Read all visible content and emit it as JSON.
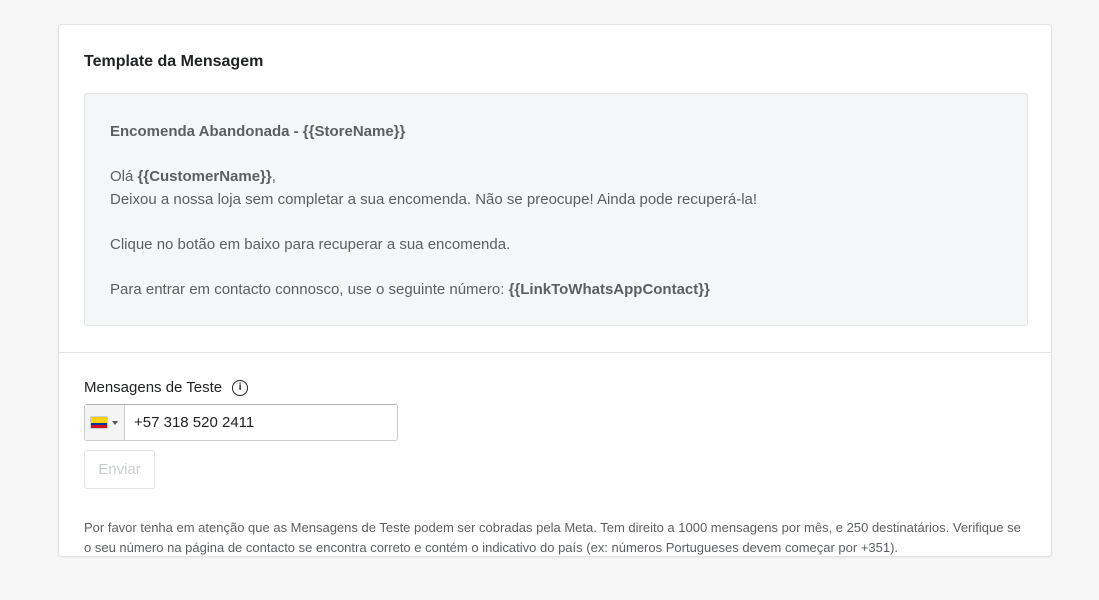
{
  "card": {
    "title": "Template da Mensagem"
  },
  "template": {
    "subject_prefix": "Encomenda Abandonada - ",
    "subject_var": "{{StoreName}}",
    "greeting_prefix": "Olá ",
    "greeting_var": "{{CustomerName}}",
    "greeting_suffix": ",",
    "body_line": "Deixou a nossa loja sem completar a sua encomenda. Não se preocupe! Ainda pode recuperá-la!",
    "cta_line": "Clique no botão em baixo para recuperar a sua encomenda.",
    "contact_prefix": "Para entrar em contacto connosco, use o seguinte número: ",
    "contact_var": "{{LinkToWhatsAppContact}}"
  },
  "test_messages": {
    "label": "Mensagens de Teste",
    "info_icon": "info-icon",
    "country_flag": "colombia-flag",
    "phone_value": "+57 318 520 2411",
    "send_label": "Enviar",
    "help_text": "Por favor tenha em atenção que as Mensagens de Teste podem ser cobradas pela Meta. Tem direito a 1000 mensagens por mês, e 250 destinatários. Verifique se o seu número na página de contacto se encontra correto e contém o indicativo do país (ex: números Portugueses devem começar por +351)."
  },
  "colors": {
    "background": "#f6f6f7",
    "card": "#ffffff",
    "template_box": "#f4f6f8",
    "muted_text": "#5c5f62",
    "disabled_text": "#c9cccf"
  }
}
